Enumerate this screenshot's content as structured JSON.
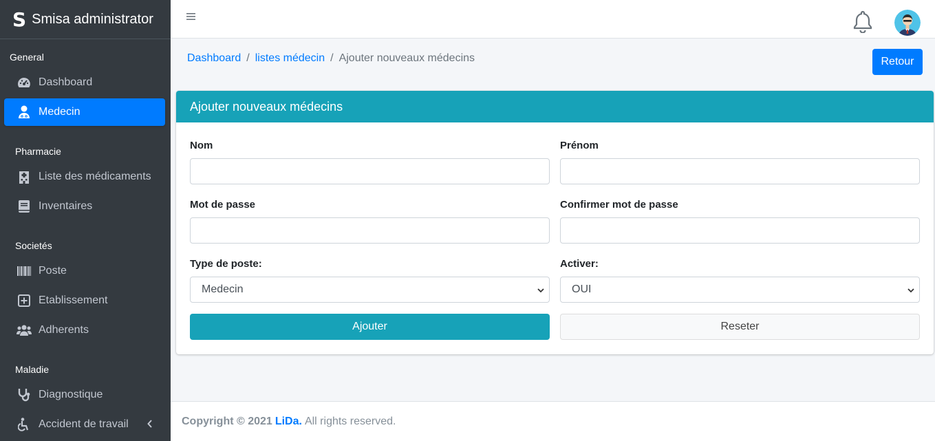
{
  "brand": {
    "logo": "S",
    "name": "Smisa administrator"
  },
  "sidebar": {
    "sections": [
      {
        "header": "General",
        "items": [
          {
            "label": "Dashboard",
            "icon": "tachometer-icon"
          },
          {
            "label": "Medecin",
            "icon": "user-md-icon",
            "active": true
          }
        ]
      },
      {
        "header": "Pharmacie",
        "items": [
          {
            "label": "Liste des médicaments",
            "icon": "hospital-icon"
          },
          {
            "label": "Inventaires",
            "icon": "book-icon"
          }
        ]
      },
      {
        "header": "Societés",
        "items": [
          {
            "label": "Poste",
            "icon": "barcode-icon"
          },
          {
            "label": "Etablissement",
            "icon": "plus-square-icon"
          },
          {
            "label": "Adherents",
            "icon": "users-icon"
          }
        ]
      },
      {
        "header": "Maladie",
        "items": [
          {
            "label": "Diagnostique",
            "icon": "stethoscope-icon"
          },
          {
            "label": "Accident de travail",
            "icon": "wheelchair-icon"
          }
        ]
      }
    ]
  },
  "breadcrumb": {
    "items": [
      "Dashboard",
      "listes médecin"
    ],
    "current": "Ajouter nouveaux médecins"
  },
  "retour_label": "Retour",
  "form": {
    "title": "Ajouter nouveaux médecins",
    "nom_label": "Nom",
    "nom_value": "",
    "prenom_label": "Prénom",
    "prenom_value": "",
    "password_label": "Mot de passe",
    "password_value": "",
    "confirm_label": "Confirmer mot de passe",
    "confirm_value": "",
    "type_label": "Type de poste:",
    "type_value": "Medecin",
    "activer_label": "Activer:",
    "activer_value": "OUI",
    "submit_label": "Ajouter",
    "reset_label": "Reseter"
  },
  "footer": {
    "copyright": "Copyright © 2021",
    "brand": "LiDa.",
    "rights": "All rights reserved."
  },
  "colors": {
    "sidebar": "#343a40",
    "primary": "#007bff",
    "info": "#17a2b8"
  }
}
